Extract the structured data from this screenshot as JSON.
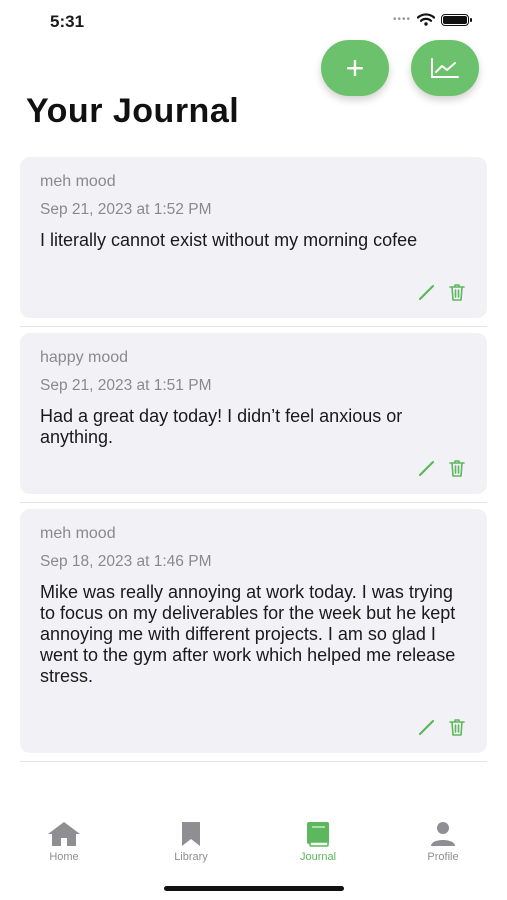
{
  "status_bar": {
    "time": "5:31"
  },
  "header": {
    "title": "Your Journal"
  },
  "actions": {
    "add_label": "+"
  },
  "colors": {
    "accent": "#6cc26c",
    "card_bg": "#f2f2f6",
    "muted_text": "#8a8a8e",
    "tab_inactive": "#8e8e93",
    "tab_active": "#5cb85c"
  },
  "entries": [
    {
      "mood": "meh mood",
      "date": "Sep 21, 2023 at 1:52 PM",
      "text": "I literally cannot exist without my morning cofee"
    },
    {
      "mood": "happy mood",
      "date": "Sep 21, 2023 at 1:51 PM",
      "text": "Had a great day today! I didn’t feel anxious or anything."
    },
    {
      "mood": "meh mood",
      "date": "Sep 18, 2023 at 1:46 PM",
      "text": "Mike was really annoying at work today. I was trying to focus on my deliverables for the week but he kept annoying me with different projects. I am so glad I went to the gym after work which helped me release stress."
    }
  ],
  "tabs": [
    {
      "label": "Home",
      "icon": "home-icon"
    },
    {
      "label": "Library",
      "icon": "bookmark-icon"
    },
    {
      "label": "Journal",
      "icon": "book-icon",
      "active": true
    },
    {
      "label": "Profile",
      "icon": "person-icon"
    }
  ]
}
